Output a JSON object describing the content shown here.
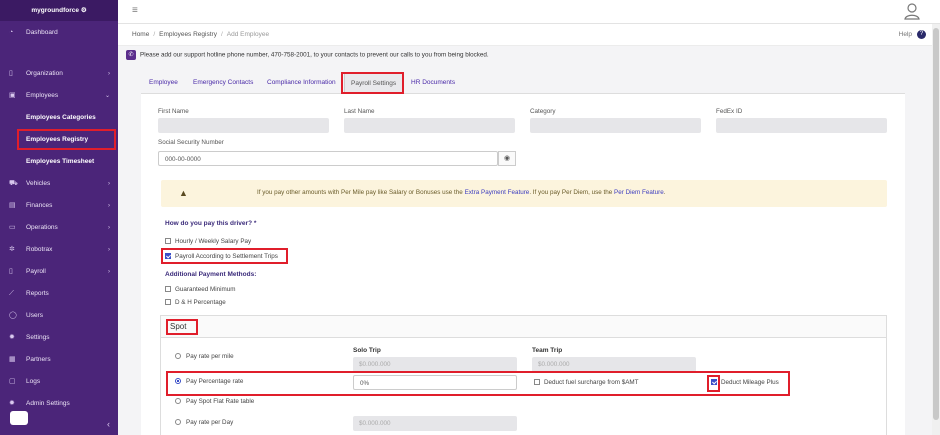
{
  "app": {
    "brand": "mygroundforce"
  },
  "sidebar": {
    "items": [
      {
        "label": "Dashboard",
        "icon": "dashboard-icon",
        "glyph": "◔"
      },
      {
        "label": "Organization",
        "icon": "building-icon",
        "glyph": "▯"
      },
      {
        "label": "Employees",
        "icon": "people-icon",
        "glyph": "▣"
      },
      {
        "label": "Employees Categories"
      },
      {
        "label": "Employees Registry"
      },
      {
        "label": "Employees Timesheet"
      },
      {
        "label": "Vehicles",
        "icon": "truck-icon",
        "glyph": "⛟"
      },
      {
        "label": "Finances",
        "icon": "wallet-icon",
        "glyph": "▤"
      },
      {
        "label": "Operations",
        "icon": "operations-icon",
        "glyph": "▭"
      },
      {
        "label": "Robotrax",
        "icon": "gear-icon",
        "glyph": "✲"
      },
      {
        "label": "Payroll",
        "icon": "document-icon",
        "glyph": "▯"
      },
      {
        "label": "Reports",
        "icon": "chart-icon",
        "glyph": "⟋"
      },
      {
        "label": "Users",
        "icon": "user-icon",
        "glyph": "◯"
      },
      {
        "label": "Settings",
        "icon": "settings-icon",
        "glyph": "✹"
      },
      {
        "label": "Partners",
        "icon": "grid-icon",
        "glyph": "▦"
      },
      {
        "label": "Logs",
        "icon": "file-icon",
        "glyph": "▢"
      },
      {
        "label": "Admin Settings",
        "icon": "admin-icon",
        "glyph": "✹"
      }
    ]
  },
  "breadcrumb": {
    "home": "Home",
    "registry": "Employees Registry",
    "current": "Add Employee"
  },
  "help": "Help",
  "notice": "Please add our support hotline phone number, 470-758-2001, to your contacts to prevent our calls to you from being blocked.",
  "tabs": [
    "Employee",
    "Emergency Contacts",
    "Compliance Information",
    "Payroll Settings",
    "HR Documents"
  ],
  "form": {
    "first_name": "First Name",
    "last_name": "Last Name",
    "category": "Category",
    "fedex_id": "FedEx ID",
    "ssn_label": "Social Security Number",
    "ssn_placeholder": "000-00-0000",
    "warning_a": "If you pay other amounts with Per Mile pay like Salary or Bonuses use the ",
    "warning_link1": "Extra Payment Feature",
    "warning_b": ". If you pay Per Diem, use the ",
    "warning_link2": "Per Diem Feature",
    "warning_c": ".",
    "question": "How do you pay this driver? *",
    "opt_hourly": "Hourly / Weekly Salary Pay",
    "opt_settlement": "Payroll According to Settlement Trips",
    "additional": "Additional Payment Methods:",
    "opt_guaranteed": "Guaranteed Minimum",
    "opt_dh": "D & H Percentage"
  },
  "spot": {
    "title": "Spot",
    "solo_trip": "Solo Trip",
    "team_trip": "Team Trip",
    "rate_per_mile": "Pay rate per mile",
    "solo_value": "$0.000.000",
    "team_value": "$0.000.000",
    "percentage": "Pay Percentage rate",
    "percentage_value": "0%",
    "deduct_fuel": "Deduct fuel surcharge from $AMT",
    "deduct_mileage": "Deduct Mileage Plus",
    "flat_rate": "Pay Spot Flat Rate table",
    "per_day": "Pay rate per Day",
    "per_day_value": "$0.000.000"
  }
}
